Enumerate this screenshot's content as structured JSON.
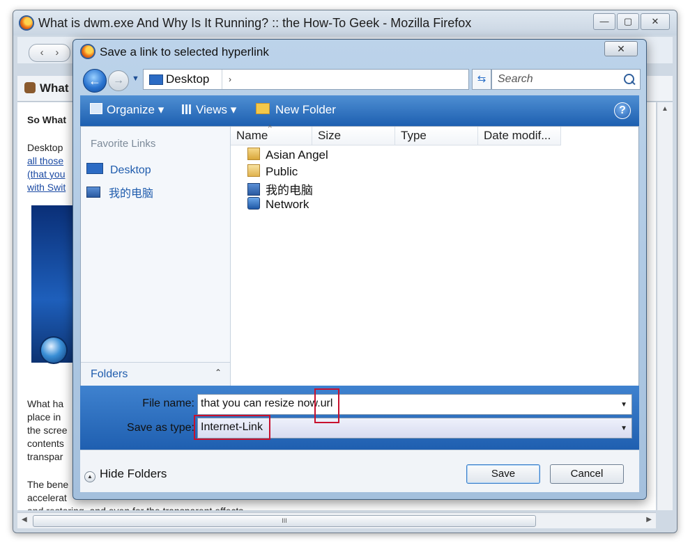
{
  "browser": {
    "title": "What is dwm.exe And Why Is It Running? :: the How-To Geek - Mozilla Firefox",
    "controls": {
      "minimize": "—",
      "maximize": "▢",
      "close": "✕"
    },
    "nav": {
      "back": "‹",
      "forward": "›"
    },
    "tab_label": "What",
    "content_lines": [
      {
        "text": "So What",
        "style": "bold"
      },
      {
        "text": "Desktop",
        "style": "normal"
      },
      {
        "text": "all those",
        "style": "link"
      },
      {
        "text": "(that you",
        "style": "link"
      },
      {
        "text": "with Swit",
        "style": "link"
      },
      {
        "text": "What ha",
        "style": "normal"
      },
      {
        "text": "place in",
        "style": "normal"
      },
      {
        "text": "the scree",
        "style": "normal"
      },
      {
        "text": "contents",
        "style": "normal"
      },
      {
        "text": "transpar",
        "style": "normal"
      },
      {
        "text": "The bene",
        "style": "normal"
      },
      {
        "text": "accelerat",
        "style": "normal"
      },
      {
        "text": "and restoring, and even for the transparent effects.",
        "style": "normal"
      }
    ],
    "hscroll_grip": "III"
  },
  "dialog": {
    "title": "Save a link to selected hyperlink",
    "close_label": "✕",
    "address": {
      "location": "Desktop",
      "chevron": "›",
      "dropdown": "▾"
    },
    "search_placeholder": "Search",
    "toolbar": {
      "organize": "Organize ▾",
      "views": "Views ▾",
      "new_folder": "New Folder",
      "help": "?"
    },
    "favorites": {
      "heading": "Favorite Links",
      "items": [
        "Desktop",
        "我的电脑"
      ]
    },
    "folders_label": "Folders",
    "folders_toggle": "⌃",
    "columns": [
      "Name",
      "Size",
      "Type",
      "Date modif..."
    ],
    "sort_caret": "^",
    "files": [
      {
        "name": "Asian Angel",
        "icon": "user-folder-icon"
      },
      {
        "name": "Public",
        "icon": "folder-icon"
      },
      {
        "name": "我的电脑",
        "icon": "computer-icon"
      },
      {
        "name": "Network",
        "icon": "network-icon"
      }
    ],
    "file_name": {
      "label": "File name:",
      "value": "that you can resize now.url"
    },
    "save_as_type": {
      "label": "Save as type:",
      "value": "Internet-Link"
    },
    "hide_folders": "Hide Folders",
    "save_button": "Save",
    "cancel_button": "Cancel",
    "highlight_color": "#c8102e"
  }
}
